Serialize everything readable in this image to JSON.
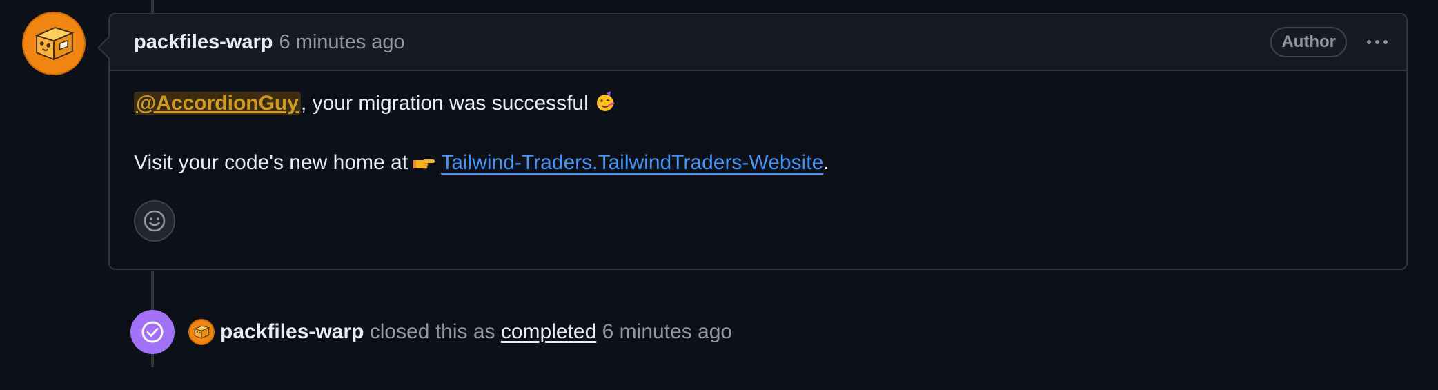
{
  "comment": {
    "author": "packfiles-warp",
    "timestamp": "6 minutes ago",
    "badge": "Author",
    "more_icon": "kebab-horizontal-icon",
    "mention": "@AccordionGuy",
    "line1_text": ", your migration was successful",
    "line1_emoji": "partying-face",
    "line2_prefix": "Visit your code's new home at",
    "line2_emoji": "pointing-hand",
    "repo_link": "Tailwind-Traders.TailwindTraders-Website",
    "line2_suffix": ".",
    "reaction_icon": "smiley-icon"
  },
  "event": {
    "icon": "check-circle-icon",
    "author": "packfiles-warp",
    "action": "closed this as",
    "state": "completed",
    "timestamp": "6 minutes ago"
  },
  "colors": {
    "background": "#0d1117",
    "header_bg": "#161b22",
    "border": "#30363d",
    "link": "#4493f8",
    "mention": "#d29922",
    "event_purple": "#a371f7",
    "avatar_orange": "#f0860f"
  }
}
